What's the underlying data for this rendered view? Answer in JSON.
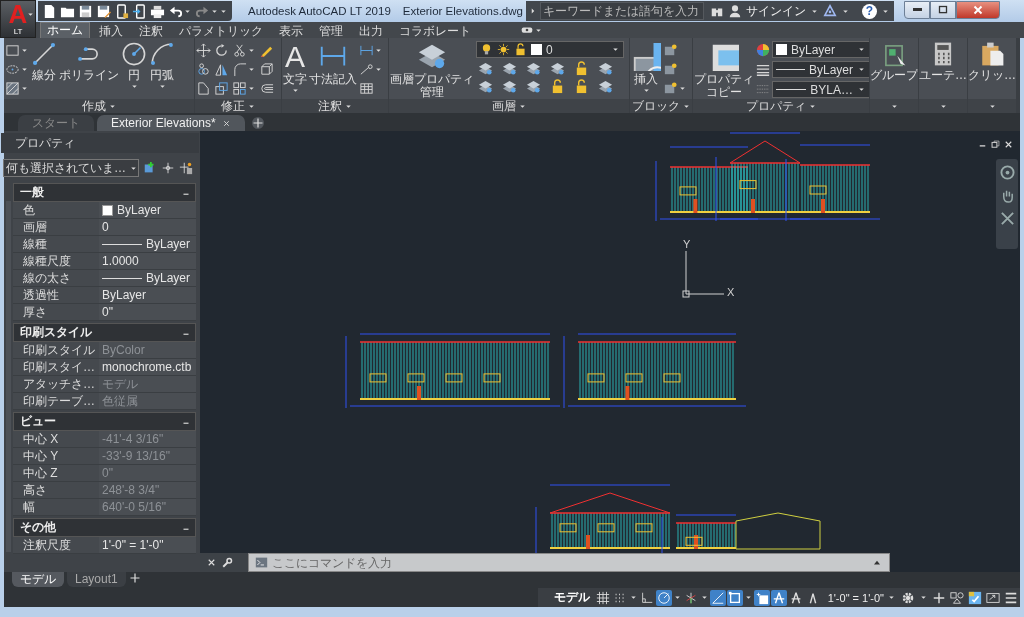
{
  "title_bar": {
    "app_letter": "A",
    "app_edition": "LT",
    "title": "Autodesk AutoCAD LT 2019",
    "file": "Exterior Elevations.dwg",
    "search_placeholder": "キーワードまたは語句を入力",
    "signin": "サインイン",
    "help": "?"
  },
  "ribbon_tabs": [
    {
      "label": "ホーム",
      "selected": true
    },
    {
      "label": "挿入",
      "selected": false
    },
    {
      "label": "注釈",
      "selected": false
    },
    {
      "label": "パラメトリック",
      "selected": false
    },
    {
      "label": "表示",
      "selected": false
    },
    {
      "label": "管理",
      "selected": false
    },
    {
      "label": "出力",
      "selected": false
    },
    {
      "label": "コラボレート",
      "selected": false
    }
  ],
  "ribbon_panels": [
    {
      "title": "作成",
      "tools": [
        {
          "lines": [
            "線分"
          ],
          "dropdown": false
        },
        {
          "lines": [
            "ポリライン"
          ],
          "dropdown": false
        },
        {
          "lines": [
            "円"
          ],
          "dropdown": true
        },
        {
          "lines": [
            "円弧"
          ],
          "dropdown": true
        }
      ]
    },
    {
      "title": "修正"
    },
    {
      "title": "注釈",
      "tools": [
        {
          "lines": [
            "文字"
          ],
          "dropdown": true,
          "glyph": "A"
        },
        {
          "lines": [
            "寸法記入"
          ],
          "dropdown": false
        }
      ]
    },
    {
      "title": "画層",
      "tools": [
        {
          "lines": [
            "画層プロパティ",
            "管理"
          ],
          "dropdown": false
        }
      ],
      "layer": "0"
    },
    {
      "title": "ブロック",
      "tools": [
        {
          "lines": [
            "挿入"
          ],
          "dropdown": true
        }
      ]
    },
    {
      "title": "プロパティ",
      "tools": [
        {
          "lines": [
            "プロパティ",
            "コピー"
          ],
          "dropdown": false
        }
      ],
      "combos": [
        {
          "kind": "color",
          "value": "ByLayer"
        },
        {
          "kind": "linetype",
          "value": "ByLayer"
        },
        {
          "kind": "lineweight",
          "value": "BYLA…"
        }
      ]
    },
    {
      "tools": [
        {
          "lines": [
            "グループ"
          ],
          "dropdown": false
        }
      ]
    },
    {
      "tools": [
        {
          "lines": [
            "ユーテ…"
          ],
          "dropdown": false
        }
      ]
    },
    {
      "tools": [
        {
          "lines": [
            "クリッ…"
          ],
          "dropdown": false
        }
      ]
    }
  ],
  "document_tabs": [
    {
      "label": "スタート",
      "selected": false,
      "closable": false
    },
    {
      "label": "Exterior Elevations*",
      "selected": true,
      "closable": true
    }
  ],
  "properties": {
    "title": "プロパティ",
    "selection": "何も選択されていま…",
    "sections": [
      {
        "title": "一般",
        "expanded": true,
        "rows": [
          {
            "label": "色",
            "value": "ByLayer",
            "kind": "color",
            "disabled": false
          },
          {
            "label": "画層",
            "value": "0",
            "kind": "text",
            "disabled": false
          },
          {
            "label": "線種",
            "value": "ByLayer",
            "kind": "linetype",
            "disabled": false
          },
          {
            "label": "線種尺度",
            "value": "1.0000",
            "kind": "text",
            "disabled": false
          },
          {
            "label": "線の太さ",
            "value": "ByLayer",
            "kind": "linetype",
            "disabled": false
          },
          {
            "label": "透過性",
            "value": "ByLayer",
            "kind": "text",
            "disabled": false
          },
          {
            "label": "厚さ",
            "value": "0\"",
            "kind": "text",
            "disabled": false
          }
        ]
      },
      {
        "title": "印刷スタイル",
        "expanded": true,
        "rows": [
          {
            "label": "印刷スタイル",
            "value": "ByColor",
            "kind": "text",
            "disabled": true
          },
          {
            "label": "印刷スタイ…",
            "value": "monochrome.ctb",
            "kind": "text",
            "disabled": false
          },
          {
            "label": "アタッチさ…",
            "value": "モデル",
            "kind": "text",
            "disabled": true
          },
          {
            "label": "印刷テーブ…",
            "value": "色従属",
            "kind": "text",
            "disabled": true
          }
        ]
      },
      {
        "title": "ビュー",
        "expanded": true,
        "rows": [
          {
            "label": "中心 X",
            "value": "-41'-4 3/16\"",
            "kind": "text",
            "disabled": true
          },
          {
            "label": "中心 Y",
            "value": "-33'-9 13/16\"",
            "kind": "text",
            "disabled": true
          },
          {
            "label": "中心 Z",
            "value": "0\"",
            "kind": "text",
            "disabled": true
          },
          {
            "label": "高さ",
            "value": "248'-8 3/4\"",
            "kind": "text",
            "disabled": true
          },
          {
            "label": "幅",
            "value": "640'-0 5/16\"",
            "kind": "text",
            "disabled": true
          }
        ]
      },
      {
        "title": "その他",
        "expanded": true,
        "rows": [
          {
            "label": "注釈尺度",
            "value": "1'-0\" = 1'-0\"",
            "kind": "text",
            "disabled": false
          }
        ]
      }
    ]
  },
  "canvas": {
    "ucs_y": "Y",
    "ucs_x": "X"
  },
  "command_line": {
    "placeholder": "ここにコマンドを入力"
  },
  "layout_tabs": [
    {
      "label": "モデル",
      "selected": true
    },
    {
      "label": "Layout1",
      "selected": false
    }
  ],
  "status_bar": {
    "model_button": "モデル",
    "toggles": [
      {
        "on": false
      },
      {
        "on": false
      },
      {
        "on": false
      },
      {
        "on": true
      },
      {
        "on": false
      },
      {
        "on": true
      },
      {
        "on": true
      },
      {
        "on": true
      },
      {
        "on": true
      },
      {
        "on": false
      },
      {
        "on": false
      }
    ],
    "scale": "1'-0\" = 1'-0\""
  }
}
